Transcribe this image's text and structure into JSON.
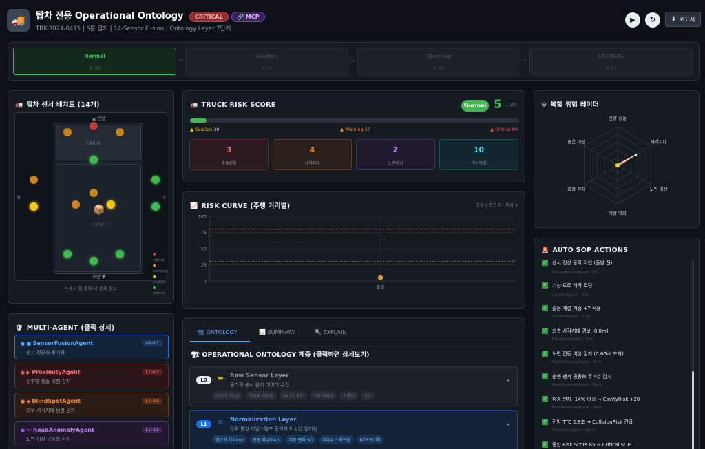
{
  "header": {
    "title": "탑차 전용 Operational Ontology",
    "badge_critical": "CRITICAL",
    "badge_mcp": "MCP",
    "subtitle": "TRK-2024-0415 | 5톤 탑차 | 14-Sensor Fusion | Ontology Layer 7단계",
    "report_label": "보고서"
  },
  "stages": [
    {
      "name": "Normal",
      "range": "≤ 30",
      "active": true
    },
    {
      "name": "Caution",
      "range": "≤ 30",
      "active": false
    },
    {
      "name": "Warning",
      "range": "≤ 60",
      "active": false
    },
    {
      "name": "CRITICAL",
      "range": "≤ 80",
      "active": false
    }
  ],
  "sensor_map": {
    "title": "탑차 센서 배치도 (14개)",
    "front_label": "▲ 전방",
    "rear_label": "후방 ▼",
    "left_label": "좌",
    "right_label": "우",
    "cabin_label": "CABIN",
    "cargo_label": "CARGO",
    "legend": [
      "critical",
      "warning",
      "caution",
      "normal"
    ],
    "footer": "* 센서 점 클릭 시 상세 정보"
  },
  "risk_score": {
    "title": "TRUCK RISK SCORE",
    "status": "Normal",
    "score": "5",
    "max": "/100",
    "fill_percent": 5,
    "threshold_caution": "▲ Caution 30",
    "threshold_warning": "▲ Warning 50",
    "threshold_critical": "▲ Critical 80",
    "cards": [
      {
        "value": "3",
        "label": "충돌위험"
      },
      {
        "value": "4",
        "label": "사각지대"
      },
      {
        "value": "2",
        "label": "노면이상"
      },
      {
        "value": "10",
        "label": "기상악화"
      }
    ]
  },
  "risk_curve": {
    "title": "RISK CURVE (주행 거리별)",
    "meta": "출발 | 중간 5 | 중심 3",
    "xlabel": "출발"
  },
  "chart_data": {
    "type": "line",
    "title": "RISK CURVE (주행 거리별)",
    "categories": [
      "출발"
    ],
    "series": [
      {
        "values": [
          5
        ]
      }
    ],
    "yticks": [
      0,
      25,
      50,
      75,
      100
    ],
    "ylim": [
      0,
      100
    ],
    "thresholds": [
      30,
      60,
      80
    ]
  },
  "radar": {
    "title": "복합 위험 레이더",
    "axes": [
      "전방 충돌",
      "사각지대",
      "노면 이상",
      "기상 악화",
      "화물 편차",
      "졸음 이상"
    ],
    "values": [
      0.03,
      0.55,
      0.03,
      0.03,
      0.03,
      0.03
    ]
  },
  "agents": {
    "title": "MULTI-AGENT (클릭 상세)",
    "items": [
      {
        "name": "SensorFusionAgent",
        "desc": "센서 정규화·동기화",
        "level": "L0~L1"
      },
      {
        "name": "ProximityAgent",
        "desc": "전후방 충돌 위험 감지",
        "level": "L1~L3"
      },
      {
        "name": "BlindSpotAgent",
        "desc": "좌우 사각지대 탐범 감지",
        "level": "L1~L3"
      },
      {
        "name": "RoadAnomalyAgent",
        "desc": "노면 이상·공동화 감지",
        "level": "L1~L3"
      }
    ]
  },
  "ontology": {
    "tabs": [
      "ONTOLOGY",
      "SUMMARY",
      "EXPLAIN"
    ],
    "title": "OPERATIONAL ONTOLOGY 계층 (클릭하면 상세보기)",
    "layers": [
      {
        "badge": "L0",
        "name": "Raw Sensor Layer",
        "desc": "물리적 센서 원시 데이터 수집",
        "tags": [
          "레이더 거리값",
          "초음파 거리값",
          "IMU 가속도",
          "조향 주파수",
          "하중값",
          "온도"
        ]
      },
      {
        "badge": "L1",
        "name": "Normalization Layer",
        "desc": "단위 통일·타임스탬프 동기화·이상값 필터링",
        "tags": [
          "정규화 거리(m)",
          "진동 지수(Gal)",
          "하중 편차(%)",
          "주파수 스펙트럼",
          "NTP 동기화"
        ]
      }
    ]
  },
  "sop": {
    "title": "AUTO SOP ACTIONS",
    "items": [
      {
        "text": "센서 정상 동작 확인 (출발 전)",
        "agent": "SensorFusionAgent · 완료"
      },
      {
        "text": "기상·도로 맥락 로딩",
        "agent": "ContextAgent · 완료"
      },
      {
        "text": "졸음 계절 가중 +7 적용",
        "agent": "ContextAgent · 1km"
      },
      {
        "text": "좌측 사각지대 경보 (0.8m)",
        "agent": "BlindSpotAgent · 3km"
      },
      {
        "text": "노면 진동 이상 감지 (0.6Gal 초과)",
        "agent": "RoadAnomalyAgent · 7km"
      },
      {
        "text": "운행 센서 공동화 주파수 감지",
        "agent": "RoadAnomalyAgent · 8km"
      },
      {
        "text": "하중 편차 -14% 이상 → CavityRisk +20",
        "agent": "RoadAnomalyAgent · 9km"
      },
      {
        "text": "전방 TTC 2.8초 → CollisionRisk 긴급",
        "agent": "ProximityAgent · 11km"
      },
      {
        "text": "종합 Risk Score 85 → Critical SOP",
        "agent": ""
      }
    ]
  }
}
